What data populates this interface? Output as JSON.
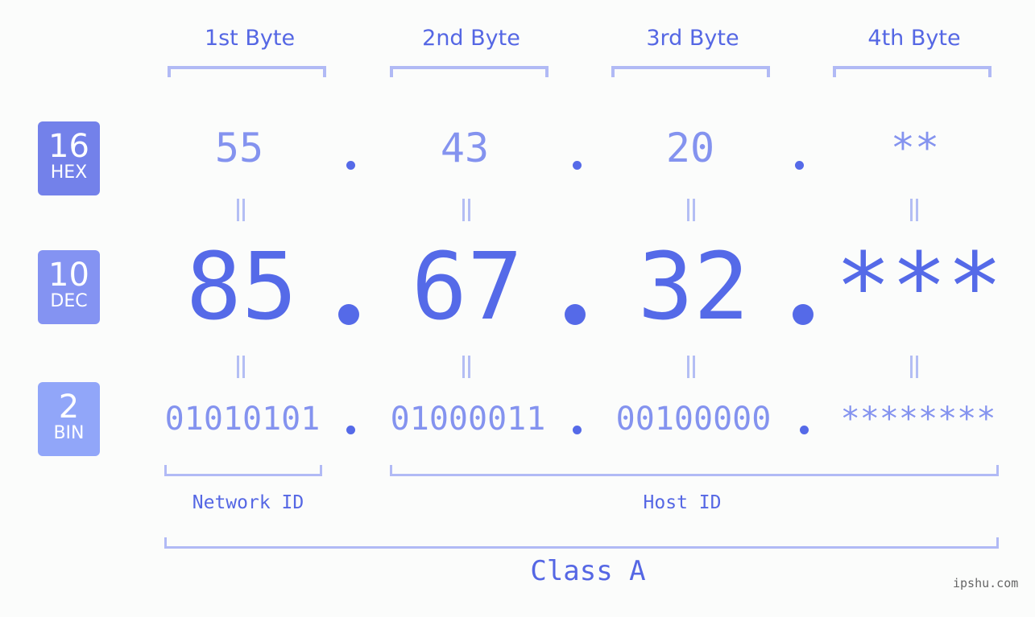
{
  "byte_headers": [
    "1st Byte",
    "2nd Byte",
    "3rd Byte",
    "4th Byte"
  ],
  "rows": {
    "hex": {
      "base": "16",
      "label": "HEX",
      "values": [
        "55",
        "43",
        "20",
        "**"
      ],
      "color": "#7381ea"
    },
    "dec": {
      "base": "10",
      "label": "DEC",
      "values": [
        "85",
        "67",
        "32",
        "***"
      ],
      "color": "#8493f2"
    },
    "bin": {
      "base": "2",
      "label": "BIN",
      "values": [
        "01010101",
        "01000011",
        "00100000",
        "********"
      ],
      "color": "#91a6f9"
    }
  },
  "separator": ".",
  "network_id_label": "Network ID",
  "host_id_label": "Host ID",
  "class_label": "Class A",
  "watermark": "ipshu.com",
  "colors": {
    "accent": "#556ae8",
    "light": "#8493ef",
    "bracket": "#b1baf5",
    "background": "#fbfcfb"
  }
}
